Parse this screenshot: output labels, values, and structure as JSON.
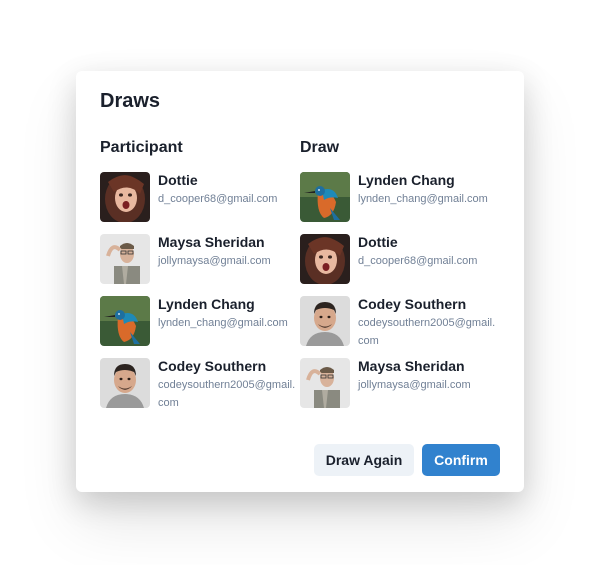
{
  "modal": {
    "title": "Draws",
    "participant_header": "Participant",
    "draw_header": "Draw",
    "participants": [
      {
        "name": "Dottie",
        "email": "d_cooper68@gmail.com",
        "avatar": "woman-avatar"
      },
      {
        "name": "Maysa Sheridan",
        "email": "jollymaysa@gmail.com",
        "avatar": "man-glasses-avatar"
      },
      {
        "name": "Lynden Chang",
        "email": "lynden_chang@gmail.com",
        "avatar": "kingfisher-avatar"
      },
      {
        "name": "Codey Southern",
        "email": "codeysouthern2005@gmail.com",
        "avatar": "man-avatar"
      }
    ],
    "draws": [
      {
        "name": "Lynden Chang",
        "email": "lynden_chang@gmail.com",
        "avatar": "kingfisher-avatar"
      },
      {
        "name": "Dottie",
        "email": "d_cooper68@gmail.com",
        "avatar": "woman-avatar"
      },
      {
        "name": "Codey Southern",
        "email": "codeysouthern2005@gmail.com",
        "avatar": "man-avatar"
      },
      {
        "name": "Maysa Sheridan",
        "email": "jollymaysa@gmail.com",
        "avatar": "man-glasses-avatar"
      }
    ],
    "draw_again_label": "Draw Again",
    "confirm_label": "Confirm"
  },
  "colors": {
    "primary": "#3182ce",
    "secondary_bg": "#edf2f7",
    "text": "#1a202c",
    "muted": "#718096"
  }
}
